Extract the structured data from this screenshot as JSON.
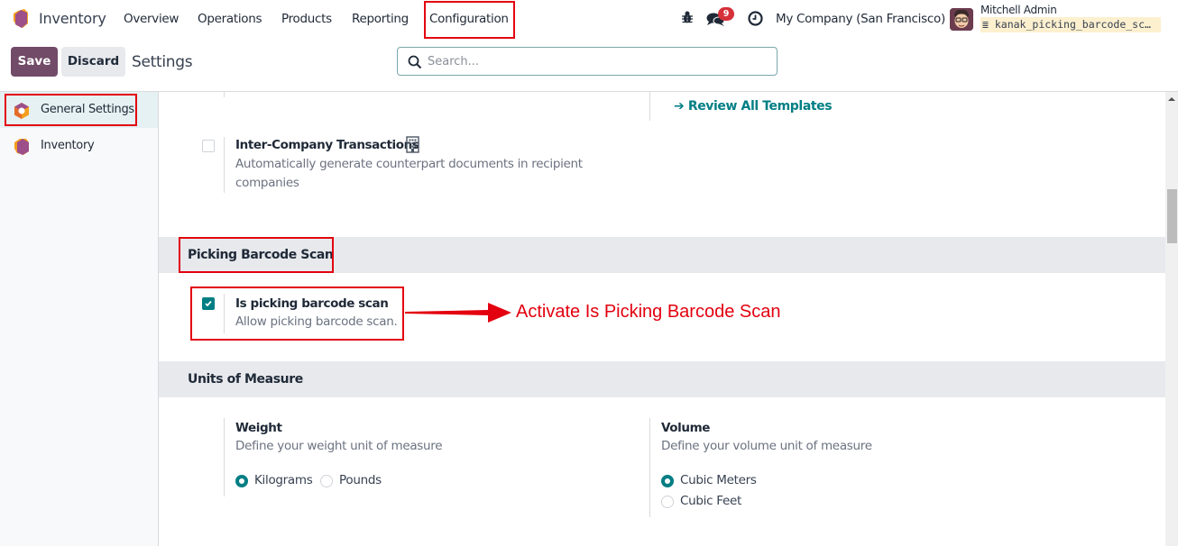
{
  "navbar": {
    "app_name": "Inventory",
    "menu": [
      "Overview",
      "Operations",
      "Products",
      "Reporting",
      "Configuration"
    ],
    "highlighted_menu": "Configuration",
    "messages_badge": "9",
    "company": "My Company (San Francisco)",
    "user_name": "Mitchell Admin",
    "database": "kanak_picking_barcode_sc…"
  },
  "control_panel": {
    "save_label": "Save",
    "discard_label": "Discard",
    "breadcrumb": "Settings",
    "search_placeholder": "Search..."
  },
  "sidebar": {
    "items": [
      {
        "label": "General Settings",
        "active": true
      },
      {
        "label": "Inventory",
        "active": false
      }
    ]
  },
  "content": {
    "review_templates_link": "Review All Templates",
    "inter_company": {
      "title": "Inter-Company Transactions",
      "description_line1": "Automatically generate counterpart documents in recipient",
      "description_line2": "companies",
      "checked": false
    },
    "picking_section": {
      "title": "Picking Barcode Scan",
      "setting": {
        "title": "Is picking barcode scan",
        "description": "Allow picking barcode scan.",
        "checked": true
      }
    },
    "uom_section": {
      "title": "Units of Measure",
      "weight": {
        "title": "Weight",
        "description": "Define your weight unit of measure",
        "options": [
          "Kilograms",
          "Pounds"
        ],
        "selected": "Kilograms"
      },
      "volume": {
        "title": "Volume",
        "description": "Define your volume unit of measure",
        "options": [
          "Cubic Meters",
          "Cubic Feet"
        ],
        "selected": "Cubic Meters"
      }
    }
  },
  "annotation": {
    "text": "Activate Is Picking Barcode Scan",
    "color": "#e3000f"
  },
  "colors": {
    "brand": "#714b67",
    "accent": "#017e84",
    "badge": "#d6303a"
  }
}
